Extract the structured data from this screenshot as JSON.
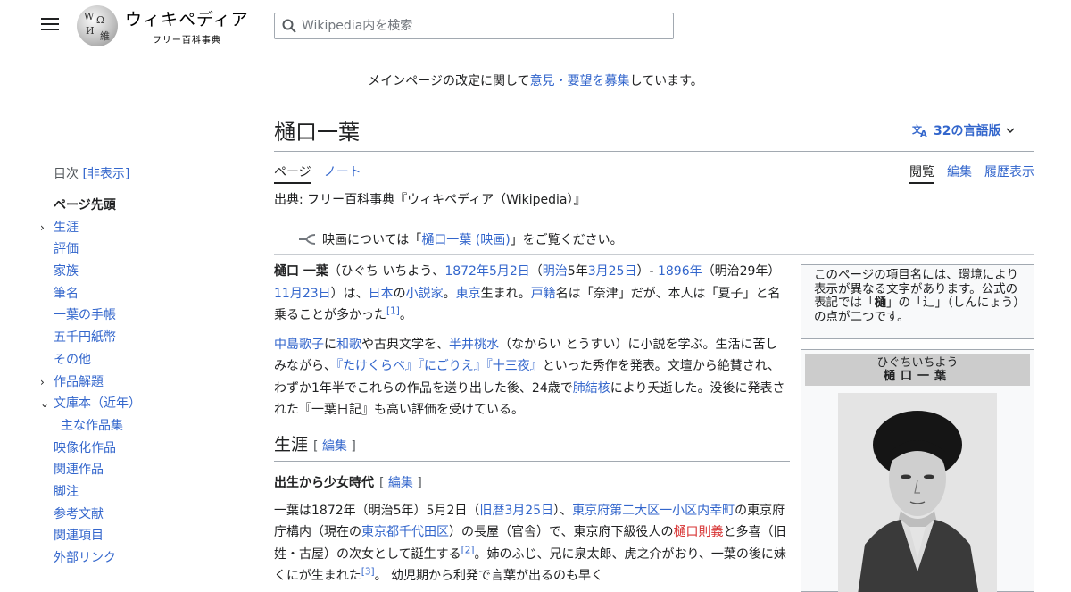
{
  "header": {
    "logo_title": "ウィキペディア",
    "logo_tagline": "フリー百科事典",
    "search_placeholder": "Wikipedia内を検索"
  },
  "notice": {
    "before": "メインページの改定に関して",
    "link": "意見・要望を募集",
    "after": "しています。"
  },
  "page": {
    "title": "樋口一葉",
    "languages": "32の言語版",
    "tabs_left": [
      "ページ",
      "ノート"
    ],
    "tabs_right": [
      "閲覧",
      "編集",
      "履歴表示"
    ],
    "source": "出典: フリー百科事典『ウィキペディア（Wikipedia）』",
    "hatnote_before": "映画については「",
    "hatnote_link": "樋口一葉 (映画)",
    "hatnote_after": "」をご覧ください。"
  },
  "toc": {
    "title": "目次",
    "toggle": "[非表示]",
    "items": [
      {
        "label": "ページ先頭"
      },
      {
        "label": "生涯",
        "tog": "›"
      },
      {
        "label": "評価"
      },
      {
        "label": "家族"
      },
      {
        "label": "筆名"
      },
      {
        "label": "一葉の手帳"
      },
      {
        "label": "五千円紙幣"
      },
      {
        "label": "その他"
      },
      {
        "label": "作品解題",
        "tog": "›"
      },
      {
        "label": "文庫本（近年）",
        "tog": "⌄"
      },
      {
        "label": "主な作品集"
      },
      {
        "label": "映像化作品"
      },
      {
        "label": "関連作品"
      },
      {
        "label": "脚注"
      },
      {
        "label": "参考文献"
      },
      {
        "label": "関連項目"
      },
      {
        "label": "外部リンク"
      }
    ]
  },
  "article": {
    "p1": {
      "name": "樋口 一葉",
      "t1": "（ひぐち いちよう、",
      "l1": "1872年",
      "l2": "5月2日",
      "t2": "（",
      "l3": "明治",
      "t3": "5年",
      "l4": "3月25日",
      "t4": "）- ",
      "l5": "1896年",
      "t5": "（明治29年）",
      "l6": "11月23日",
      "t6": "）は、",
      "l7": "日本",
      "t7": "の",
      "l8": "小説家",
      "t8": "。",
      "l9": "東京",
      "t9": "生まれ。",
      "l10": "戸籍",
      "t10": "名は「奈津」だが、本人は「夏子」と名乗ることが多かった",
      "ref": "[1]",
      "t11": "。"
    },
    "p2": {
      "l1": "中島歌子",
      "t1": "に",
      "l2": "和歌",
      "t2": "や古典文学を、",
      "l3": "半井桃水",
      "t3": "（なからい とうすい）に小説を学ぶ。生活に苦しみながら、",
      "l4": "『たけくらべ』",
      "l5": "『にごりえ』",
      "l6": "『十三夜』",
      "t4": "といった秀作を発表。文壇から絶賛され、わずか1年半でこれらの作品を送り出した後、24歳で",
      "l7": "肺結核",
      "t5": "により夭逝した。没後に発表された『一葉日記』も高い評価を受けている。"
    },
    "h2": "生涯",
    "edit": "編集",
    "h3": "出生から少女時代",
    "p3": {
      "t1": "一葉は1872年（明治5年）5月2日（",
      "l1": "旧暦",
      "l2": "3月25日",
      "t2": "）、",
      "l3": "東京府第二大区一小区内幸町",
      "t3": "の東京府庁構内（現在の",
      "l4": "東京都千代田区",
      "t4": "）の長屋（官舎）で、東京府下級役人の",
      "r1": "樋口則義",
      "t5": "と多喜（旧姓・古屋）の次女として誕生する",
      "ref1": "[2]",
      "t6": "。姉のふじ、兄に泉太郎、虎之介がおり、一葉の後に妹くにが生まれた",
      "ref2": "[3]",
      "t7": "。 幼児期から利発で言葉が出るのも早く"
    }
  },
  "namebox": {
    "t1": "このページの項目名には、環境により表示が異なる文字があります。公式の表記では「",
    "b1": "樋",
    "t2": "」の「",
    "t3": "」（しんにょう）の点が二つです。"
  },
  "infobox": {
    "reading": "ひぐちいちよう",
    "name": "樋口一葉"
  }
}
